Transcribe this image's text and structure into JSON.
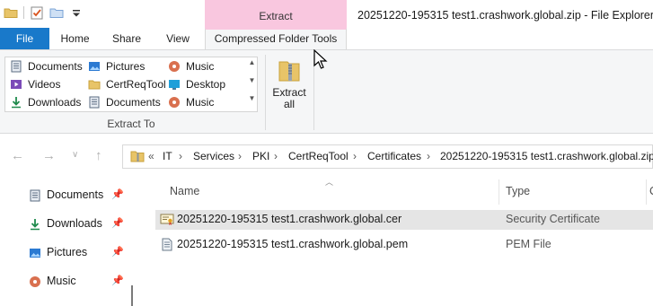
{
  "window": {
    "title": "20251220-195315 test1.crashwork.global.zip - File Explorer",
    "context_header": "Extract"
  },
  "quick_access_toolbar": {
    "icons": [
      "folder-icon",
      "properties-icon",
      "new-folder-icon",
      "customize-dropdown-icon"
    ]
  },
  "tabs": {
    "file": "File",
    "home": "Home",
    "share": "Share",
    "view": "View",
    "compressed_folder_tools": "Compressed Folder Tools"
  },
  "ribbon": {
    "gallery_items": [
      {
        "label": "Documents",
        "icon": "documents-icon"
      },
      {
        "label": "Pictures",
        "icon": "pictures-icon"
      },
      {
        "label": "Music",
        "icon": "music-icon"
      },
      {
        "label": "Videos",
        "icon": "videos-icon"
      },
      {
        "label": "CertReqTool",
        "icon": "folder-icon"
      },
      {
        "label": "Desktop",
        "icon": "desktop-icon"
      },
      {
        "label": "Downloads",
        "icon": "downloads-icon"
      },
      {
        "label": "Documents",
        "icon": "documents-icon"
      },
      {
        "label": "Music",
        "icon": "music-icon"
      }
    ],
    "group_label": "Extract To",
    "extract_all_line1": "Extract",
    "extract_all_line2": "all"
  },
  "address": {
    "overflow": "«",
    "crumbs": [
      "IT",
      "Services",
      "PKI",
      "CertReqTool",
      "Certificates",
      "20251220-195315 test1.crashwork.global.zip"
    ],
    "separator": "›"
  },
  "nav_pane": {
    "items": [
      {
        "label": "Documents",
        "icon": "documents-icon",
        "pinned": true
      },
      {
        "label": "Downloads",
        "icon": "downloads-icon",
        "pinned": true
      },
      {
        "label": "Pictures",
        "icon": "pictures-icon",
        "pinned": true
      },
      {
        "label": "Music",
        "icon": "music-icon",
        "pinned": true
      }
    ]
  },
  "file_list": {
    "columns": {
      "name": "Name",
      "type": "Type",
      "next": "C"
    },
    "rows": [
      {
        "name": "20251220-195315 test1.crashwork.global.cer",
        "type": "Security Certificate",
        "icon": "certificate-icon",
        "selected": true
      },
      {
        "name": "20251220-195315 test1.crashwork.global.pem",
        "type": "PEM File",
        "icon": "pem-file-icon",
        "selected": false
      }
    ]
  },
  "colors": {
    "file_tab": "#1979ca",
    "context_accent": "#f9c7df",
    "ribbon_bg": "#f5f6f7",
    "selected_row": "#e5e5e5"
  }
}
